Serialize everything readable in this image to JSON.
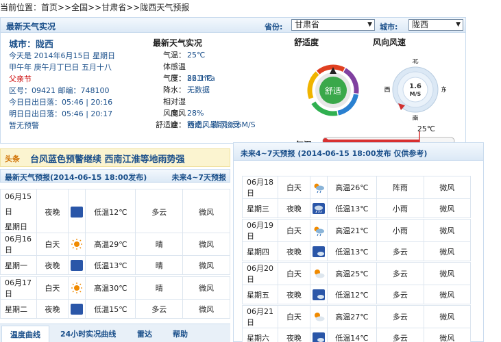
{
  "breadcrumb": "当前位置：首页>>全国>>甘肃省>>陇西天气预报",
  "top": {
    "title": "最新天气实况",
    "province_label": "省份:",
    "province_value": "甘肃省",
    "city_label": "城市:",
    "city_value": "陇西"
  },
  "info": {
    "city": "城市：陇西",
    "today": "今天是 2014年6月15日 星期日",
    "lunar": "甲午年 庚午月丁巳日 五月十八",
    "festival": "父亲节",
    "codes": "区号：09421  邮编：748100",
    "today_sun": "今日日出日落：05:46 | 20:16",
    "tomorrow_sun": "明日日出日落：05:46 | 20:17",
    "warning": "暂无预警"
  },
  "live": {
    "heading": "最新天气实况",
    "rows": [
      {
        "k": "气温：",
        "v": "25℃"
      },
      {
        "k": "体感温度：",
        "v": "26.1℃"
      },
      {
        "k": "气压：",
        "v": "821hPa"
      },
      {
        "k": "降水：",
        "v": "无数据"
      },
      {
        "k": "相对湿度：",
        "v": "28%"
      },
      {
        "k": "风向风速：",
        "v": "西南风 微风 1.6M/S"
      },
      {
        "k": "舒适度：",
        "v": "舒适，最可接受"
      }
    ]
  },
  "comfort": {
    "label": "舒适度",
    "value": "舒适"
  },
  "wind": {
    "label": "风向风速",
    "n": "北",
    "s": "南",
    "e": "东",
    "w": "西",
    "speed": "1.6",
    "unit": "M/S"
  },
  "thermo": {
    "label": "气温",
    "value_text": "25℃",
    "value": 25,
    "ticks": [
      "-50",
      "-25",
      "0",
      "25",
      "50"
    ]
  },
  "headline": {
    "tag": "头条",
    "text": "台风蓝色预警继续 西南江淮等地雨势强"
  },
  "left_panel": {
    "title": "最新天气预报(2014-06-15 18:00发布)",
    "link": "未来4~7天预报",
    "days": [
      {
        "date": "06月15日",
        "weekday": "星期日",
        "rows": [
          {
            "period": "夜晚",
            "icon": "moon-icon",
            "temp": "低温12℃",
            "high": false,
            "weather": "多云",
            "wind": "微风"
          }
        ]
      },
      {
        "date": "06月16日",
        "weekday": "星期一",
        "rows": [
          {
            "period": "白天",
            "icon": "sun-icon",
            "temp": "高温29℃",
            "high": true,
            "weather": "晴",
            "wind": "微风"
          },
          {
            "period": "夜晚",
            "icon": "moon-icon",
            "temp": "低温13℃",
            "high": false,
            "weather": "晴",
            "wind": "微风"
          }
        ]
      },
      {
        "date": "06月17日",
        "weekday": "星期二",
        "rows": [
          {
            "period": "白天",
            "icon": "sun-icon",
            "temp": "高温30℃",
            "high": true,
            "weather": "晴",
            "wind": "微风"
          },
          {
            "period": "夜晚",
            "icon": "moon-icon",
            "temp": "低温15℃",
            "high": false,
            "weather": "多云",
            "wind": "微风"
          }
        ]
      }
    ]
  },
  "bottom_tabs": [
    "温度曲线",
    "24小时实况曲线",
    "雷达",
    "帮助"
  ],
  "right_panel": {
    "title": "未来4~7天预报 (2014-06-15 18:00发布 仅供参考)",
    "days": [
      {
        "date": "06月18日",
        "weekday": "星期三",
        "rows": [
          {
            "period": "白天",
            "icon": "shower-icon",
            "temp": "高温26℃",
            "high": true,
            "weather": "阵雨",
            "wind": "微风"
          },
          {
            "period": "夜晚",
            "icon": "rain-night-icon",
            "temp": "低温13℃",
            "high": false,
            "weather": "小雨",
            "wind": "微风"
          }
        ]
      },
      {
        "date": "06月19日",
        "weekday": "星期四",
        "rows": [
          {
            "period": "白天",
            "icon": "shower-icon",
            "temp": "高温21℃",
            "high": true,
            "weather": "小雨",
            "wind": "微风"
          },
          {
            "period": "夜晚",
            "icon": "moon-cloud-icon",
            "temp": "低温13℃",
            "high": false,
            "weather": "多云",
            "wind": "微风"
          }
        ]
      },
      {
        "date": "06月20日",
        "weekday": "星期五",
        "rows": [
          {
            "period": "白天",
            "icon": "sun-cloud-icon",
            "temp": "高温25℃",
            "high": true,
            "weather": "多云",
            "wind": "微风"
          },
          {
            "period": "夜晚",
            "icon": "moon-cloud-icon",
            "temp": "低温12℃",
            "high": false,
            "weather": "多云",
            "wind": "微风"
          }
        ]
      },
      {
        "date": "06月21日",
        "weekday": "星期六",
        "rows": [
          {
            "period": "白天",
            "icon": "sun-cloud-icon",
            "temp": "高温27℃",
            "high": true,
            "weather": "多云",
            "wind": "微风"
          },
          {
            "period": "夜晚",
            "icon": "moon-cloud-icon",
            "temp": "低温14℃",
            "high": false,
            "weather": "多云",
            "wind": "微风"
          }
        ]
      }
    ]
  }
}
